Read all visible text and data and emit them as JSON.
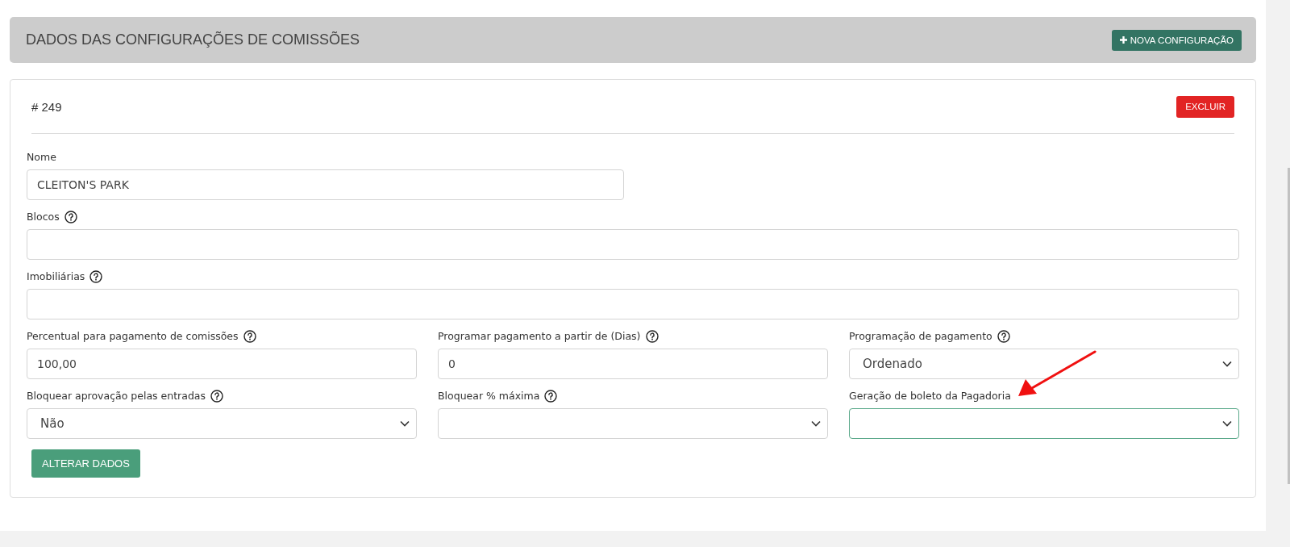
{
  "section": {
    "title": "DADOS DAS CONFIGURAÇÕES DE COMISSÕES",
    "button": {
      "label": "NOVA CONFIGURAÇÃO"
    }
  },
  "config": {
    "id": "# 249",
    "delete_button": "EXCLUIR",
    "rows": [
      [
        {
          "label": "Nome",
          "help": false,
          "kind": "text",
          "value": "CLEITON'S PARK",
          "focused": false
        }
      ],
      [
        {
          "label": "Blocos",
          "help": true,
          "kind": "text",
          "focused": false
        }
      ],
      [
        {
          "label": "Imobiliárias",
          "help": true,
          "kind": "text",
          "focused": false
        }
      ],
      [
        {
          "label": "Percentual para pagamento de comissões",
          "help": true,
          "kind": "text",
          "value": "100,00",
          "focused": false
        },
        {
          "label": "Programar pagamento a partir de (Dias)",
          "help": true,
          "kind": "text",
          "value": "0",
          "focused": false
        },
        {
          "label": "Programação de pagamento",
          "help": true,
          "kind": "select",
          "value": "Ordenado",
          "focused": false
        }
      ],
      [
        {
          "label": "Bloquear aprovação pelas entradas",
          "help": true,
          "kind": "select",
          "value": "Não",
          "focused": false
        },
        {
          "label": "Bloquear % máxima",
          "help": true,
          "kind": "select",
          "focused": false
        },
        {
          "label": "Geração de boleto da Pagadoria",
          "help": false,
          "kind": "select",
          "focused": true
        }
      ]
    ],
    "submit_button": "ALTERAR DADOS"
  },
  "annotation": {
    "kind": "arrow"
  }
}
